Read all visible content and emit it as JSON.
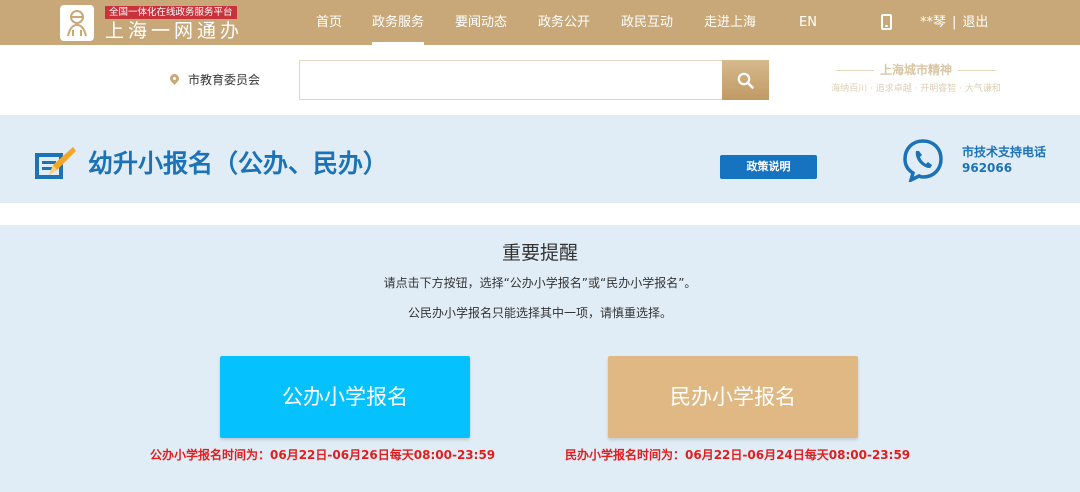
{
  "header": {
    "slogan": "全国一体化在线政务服务平台",
    "site_name": "上海一网通办",
    "nav": [
      {
        "label": "首页",
        "active": false
      },
      {
        "label": "政务服务",
        "active": true
      },
      {
        "label": "要闻动态",
        "active": false
      },
      {
        "label": "政务公开",
        "active": false
      },
      {
        "label": "政民互动",
        "active": false
      },
      {
        "label": "走进上海",
        "active": false
      },
      {
        "label": "EN",
        "active": false
      }
    ],
    "user": "**琴",
    "separator": "|",
    "logout": "退出"
  },
  "search": {
    "location": "市教育委员会",
    "placeholder": "",
    "value": ""
  },
  "spirit": {
    "title": "上海城市精神",
    "subtitle": "海纳百川 · 追求卓越 · 开明睿智 · 大气谦和"
  },
  "banner": {
    "title": "幼升小报名（公办、民办）",
    "policy_button": "政策说明",
    "support_label": "市技术支持电话",
    "support_phone": "962066"
  },
  "notice": {
    "title": "重要提醒",
    "line1": "请点击下方按钮，选择“公办小学报名”或“民办小学报名”。",
    "line2": "公民办小学报名只能选择其中一项，请慎重选择。"
  },
  "choices": {
    "public": {
      "label": "公办小学报名",
      "schedule": "公办小学报名时间为：06月22日-06月26日每天08:00-23:59"
    },
    "private": {
      "label": "民办小学报名",
      "schedule": "民办小学报名时间为：06月22日-06月24日每天08:00-23:59"
    }
  },
  "colors": {
    "header_bg": "#c8a878",
    "banner_bg": "#e1edf6",
    "accent_blue": "#1c72b6",
    "public_button": "#05c2ff",
    "private_button": "#dfb883",
    "warning_red": "#e01e1e"
  },
  "icons": {
    "logo": "site-logo-icon",
    "phone": "mobile-phone-icon",
    "location": "location-pin-icon",
    "search": "search-icon",
    "edit": "edit-form-icon",
    "support": "support-phone-icon"
  }
}
